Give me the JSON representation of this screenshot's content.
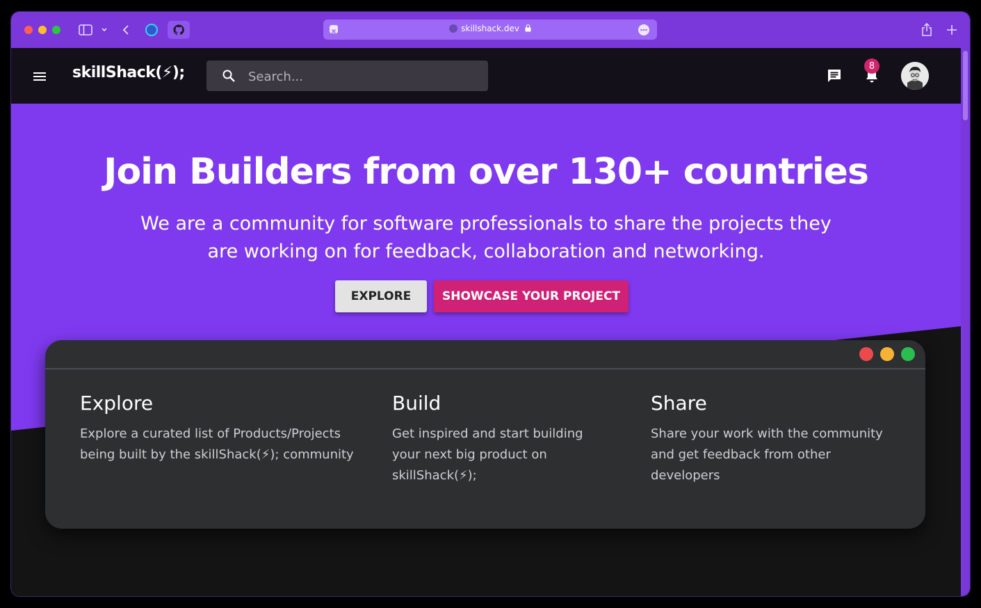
{
  "browser": {
    "url": "skillshack.dev",
    "colors": {
      "titlebar": "#7a37d9",
      "urlbar": "#9d68f5"
    },
    "icons": [
      "sidebar-icon",
      "chevron-down-icon",
      "back-icon",
      "circle-tab-icon",
      "github-icon",
      "share-icon",
      "plus-icon",
      "lock-icon",
      "more-icon"
    ]
  },
  "navbar": {
    "brand": "skillShack(⚡);",
    "search": {
      "placeholder": "Search..."
    },
    "notifications_count": "8"
  },
  "hero": {
    "title": "Join Builders from over 130+ countries",
    "subtitle": "We are a community for software professionals to share the projects they are working on for feedback, collaboration and networking.",
    "explore_label": "EXPLORE",
    "showcase_label": "SHOWCASE YOUR PROJECT",
    "colors": {
      "background": "#7f3af0",
      "showcase": "#cf2277",
      "explore": "#e3e3e3"
    }
  },
  "features": [
    {
      "title": "Explore",
      "desc": "Explore a curated list of Products/Projects being built by the skillShack(⚡); community"
    },
    {
      "title": "Build",
      "desc": "Get inspired and start building your next big product on skillShack(⚡);"
    },
    {
      "title": "Share",
      "desc": "Share your work with the community and get feedback from other developers"
    }
  ]
}
